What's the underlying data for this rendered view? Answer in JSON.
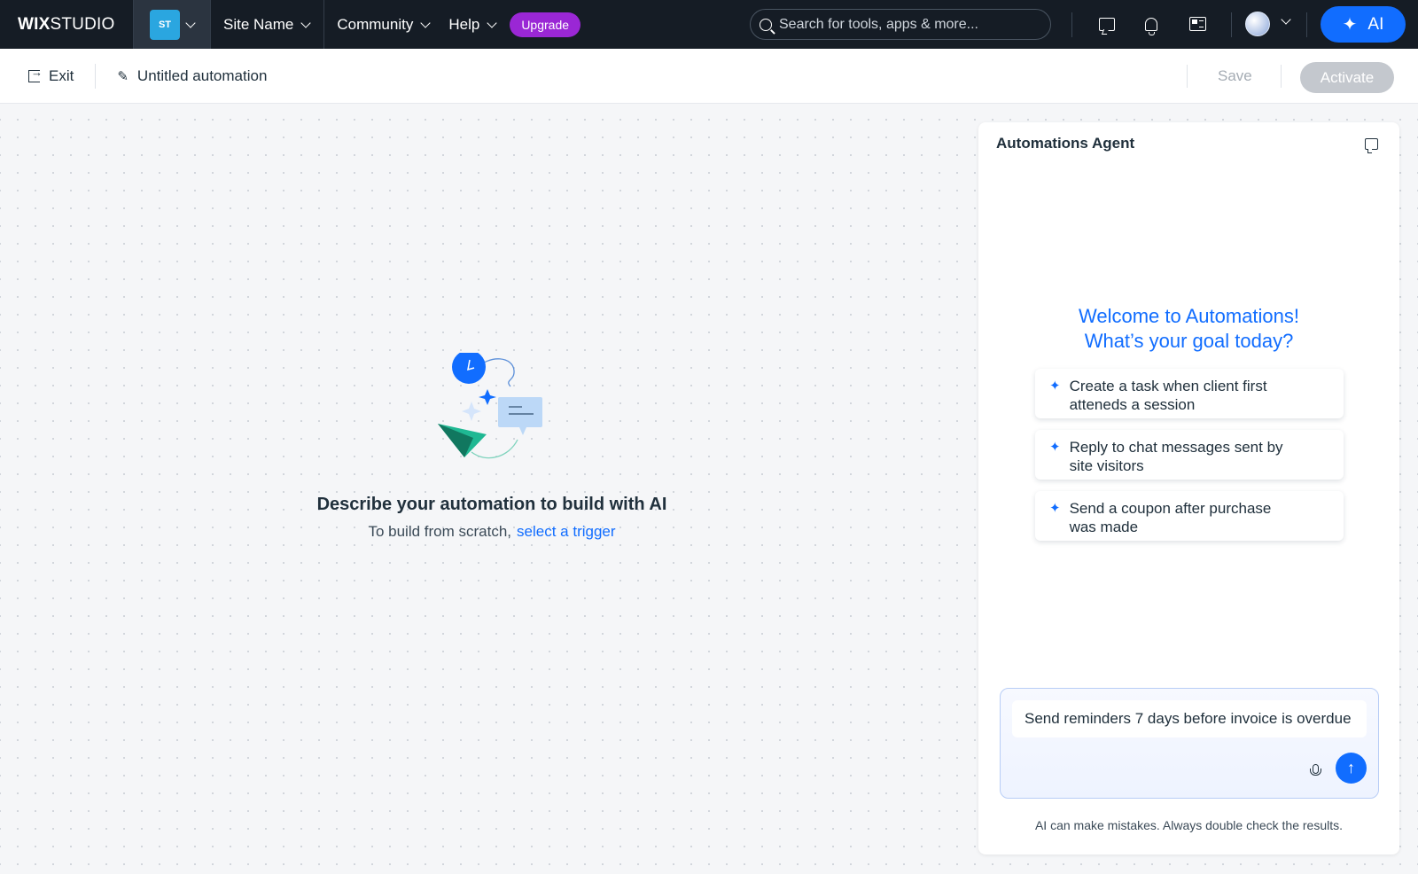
{
  "topbar": {
    "logo_bold": "WIX",
    "logo_light": "STUDIO",
    "site_initials": "ST",
    "site_name": "Site Name",
    "community": "Community",
    "help": "Help",
    "upgrade": "Upgrade",
    "search_placeholder": "Search for tools, apps & more...",
    "ai_label": "AI"
  },
  "subbar": {
    "exit": "Exit",
    "title": "Untitled automation",
    "save": "Save",
    "activate": "Activate"
  },
  "canvas": {
    "heading": "Describe your automation to build with AI",
    "sub_prefix": "To build from scratch,",
    "sub_link": "select a trigger"
  },
  "agent": {
    "title": "Automations Agent",
    "welcome_line1": "Welcome to Automations!",
    "welcome_line2": "What’s your goal today?",
    "suggestions": [
      {
        "line1": "Create a task when client first",
        "line2": "atteneds a session"
      },
      {
        "line1": "Reply to chat messages sent by",
        "line2": "site visitors"
      },
      {
        "line1": "Send a coupon after purchase",
        "line2": "was made"
      }
    ],
    "input_value": "Send reminders 7 days before invoice is overdue",
    "disclaimer": "AI can make mistakes. Always double check the results."
  },
  "colors": {
    "accent": "#116dff",
    "upgrade": "#9a27d5",
    "topbar": "#151c25"
  }
}
